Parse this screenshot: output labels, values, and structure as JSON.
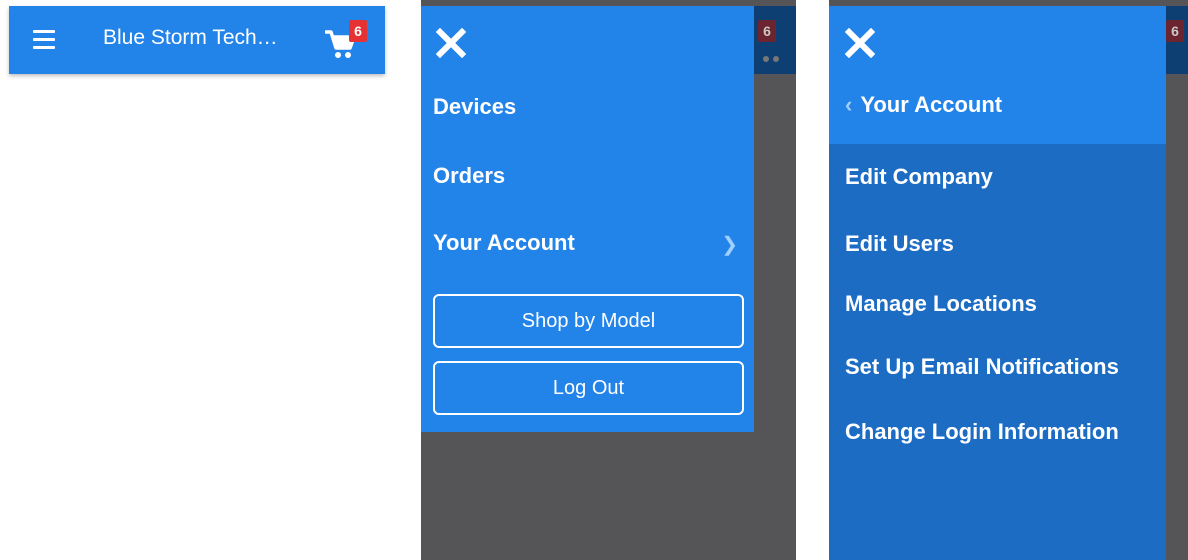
{
  "panel1": {
    "title": "Blue Storm Tech…",
    "cart_count": "6"
  },
  "panel2": {
    "cart_count": "6",
    "menu": {
      "items": [
        {
          "label": "Devices"
        },
        {
          "label": "Orders"
        },
        {
          "label": "Your Account"
        }
      ],
      "shop_button": "Shop by Model",
      "logout_button": "Log Out"
    }
  },
  "panel3": {
    "cart_count": "6",
    "back_label": "Your Account",
    "items": [
      {
        "label": "Edit Company"
      },
      {
        "label": "Edit Users"
      },
      {
        "label": "Manage Locations"
      },
      {
        "label": "Set Up Email Notifications"
      },
      {
        "label": "Change Login Information"
      }
    ]
  },
  "icons": [
    "hamburger-icon",
    "cart-icon",
    "close-icon",
    "chevron-right-icon",
    "chevron-left-icon"
  ],
  "colors": {
    "primary": "#2283e8",
    "submenu": "#1c6cc4",
    "overlay": "#555558",
    "badge": "#e53232",
    "chevron": "#9fd0ff"
  }
}
